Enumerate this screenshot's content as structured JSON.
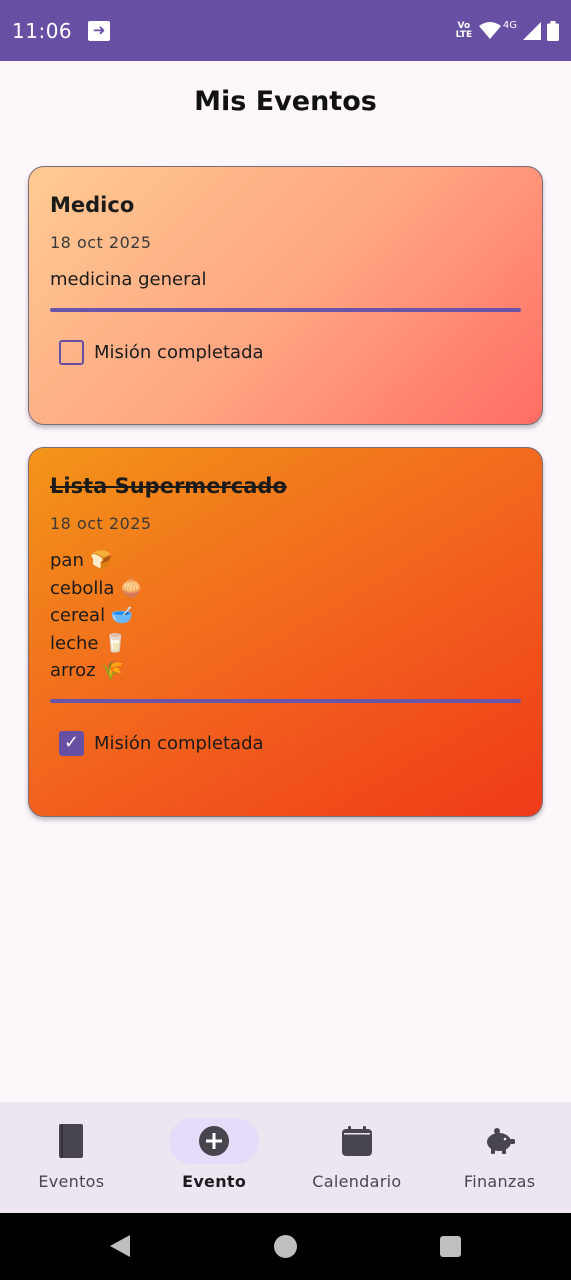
{
  "status_bar": {
    "time": "11:06",
    "network_label": "4G",
    "volte_label": "Vo LTE",
    "icons": [
      "cast-icon",
      "wifi-icon",
      "signal-icon",
      "battery-icon"
    ]
  },
  "page_title": "Mis Eventos",
  "events": [
    {
      "title": "Medico",
      "date": "18 oct 2025",
      "description": "medicina general",
      "check_label": "Misión completada",
      "completed": false
    },
    {
      "title": "Lista Supermercado",
      "date": "18 oct 2025",
      "items": [
        "pan 🍞",
        "cebolla 🧅",
        "cereal 🥣",
        "leche 🥛",
        "arroz 🌾"
      ],
      "check_label": "Misión completada",
      "completed": true
    }
  ],
  "bottom_nav": {
    "items": [
      {
        "label": "Eventos",
        "icon": "book-icon",
        "active": false
      },
      {
        "label": "Evento",
        "icon": "add-circle-icon",
        "active": true
      },
      {
        "label": "Calendario",
        "icon": "calendar-icon",
        "active": false
      },
      {
        "label": "Finanzas",
        "icon": "piggy-bank-icon",
        "active": false
      }
    ]
  },
  "colors": {
    "accent": "#6750a4",
    "card1_gradient": [
      "#ffcb93",
      "#ff6d63"
    ],
    "card2_gradient": [
      "#f29518",
      "#f03a18"
    ]
  }
}
